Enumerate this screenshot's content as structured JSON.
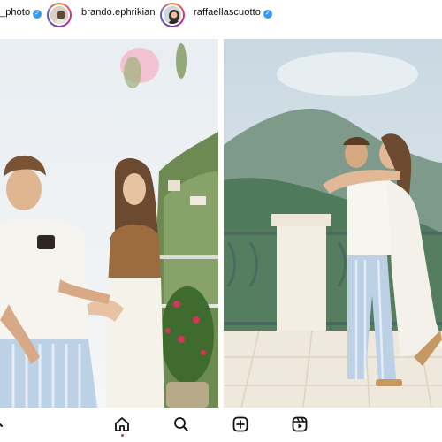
{
  "feed": {
    "accounts": [
      {
        "username": "_photo",
        "verified": true
      },
      {
        "username": "brando.ephrikian",
        "verified": false
      },
      {
        "username": "raffaellascuotto",
        "verified": true
      }
    ],
    "posts": [
      {
        "description": "couple-posing-terrace"
      },
      {
        "description": "couple-kiss-balcony"
      }
    ]
  },
  "nav": {
    "items": [
      {
        "icon": "chevron-left-icon"
      },
      {
        "icon": "home-icon",
        "active": true
      },
      {
        "icon": "search-icon"
      },
      {
        "icon": "add-post-icon"
      },
      {
        "icon": "reels-icon"
      }
    ]
  },
  "colors": {
    "verified_blue": "#3897f0",
    "active_dot": "#e0245e",
    "icon": "#111111"
  }
}
